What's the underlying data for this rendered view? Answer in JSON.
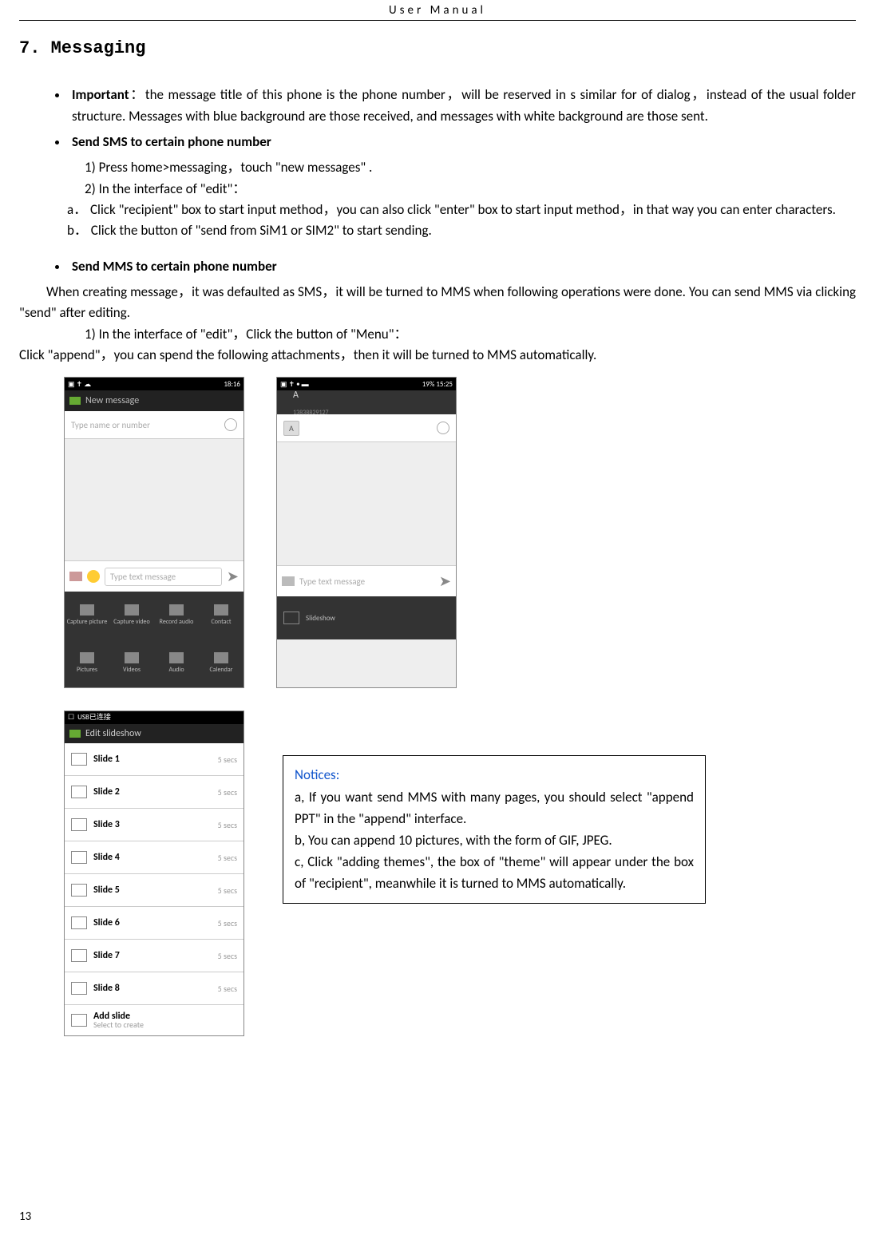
{
  "header": "User    Manual",
  "section_title": "7. Messaging",
  "b1_label": "Important",
  "b1_text": "：the message title of this phone is the phone number，will be reserved in s similar for of dialog，instead of the usual folder structure. Messages with blue background are those received, and messages with white background are those sent.",
  "b2": "Send SMS to certain phone number",
  "b2_1": "1)    Press home>messaging，touch \"new messages\" .",
  "b2_2": "2)    In the interface of \"edit\"：",
  "b2_a": "a．   Click   \"recipient\" box to start input method，you can also click \"enter\" box to start input method，in that way you can enter characters.",
  "b2_b": "b．   Click the button of   \"send from SiM1 or SIM2\" to start sending.",
  "b3": "Send MMS to certain phone number",
  "b3_intro": "When creating message，it was defaulted as SMS，it will be turned to MMS when following operations were done. You can send MMS via clicking \"send\" after editing.",
  "b3_1": "1)    In the interface of \"edit\"，Click the button of \"Menu\"：",
  "b3_append": "Click   \"append\"，you can spend the following attachments，then it will be turned to MMS automatically.",
  "ph1": {
    "status_r": "18:16",
    "title": "New message",
    "recipient_ph": "Type name or number",
    "compose_ph": "Type text message",
    "grid": [
      "Capture picture",
      "Capture video",
      "Record audio",
      "Contact",
      "Pictures",
      "Videos",
      "Audio",
      "Calendar"
    ]
  },
  "ph2": {
    "status_r": "19% 15:25",
    "num": "13838829127",
    "chip": "A",
    "compose_ph": "Type text message",
    "slide": "Slideshow"
  },
  "ph3": {
    "status": "USB已连接",
    "title": "Edit slideshow",
    "rows": [
      {
        "name": "Slide 1",
        "sec": "5 secs"
      },
      {
        "name": "Slide 2",
        "sec": "5 secs"
      },
      {
        "name": "Slide 3",
        "sec": "5 secs"
      },
      {
        "name": "Slide 4",
        "sec": "5 secs"
      },
      {
        "name": "Slide 5",
        "sec": "5 secs"
      },
      {
        "name": "Slide 6",
        "sec": "5 secs"
      },
      {
        "name": "Slide 7",
        "sec": "5 secs"
      },
      {
        "name": "Slide 8",
        "sec": "5 secs"
      }
    ],
    "add": "Add slide",
    "add_sub": "Select to create"
  },
  "notice": {
    "title": "Notices:",
    "a": "a, If you want send MMS with many pages, you should select \"append PPT\" in the \"append\" interface.",
    "b": "b, You can append 10 pictures, with the form of GIF, JPEG.",
    "c": "c, Click \"adding themes\", the box of \"theme\" will appear under the box of \"recipient\", meanwhile it is turned to MMS automatically."
  },
  "page_number": "13"
}
